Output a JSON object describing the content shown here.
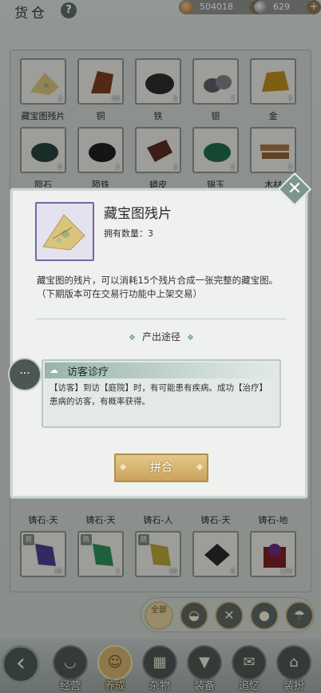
{
  "header": {
    "title": "货仓",
    "help_label": "?",
    "coins": "504018",
    "jade": "629",
    "plus_label": "+"
  },
  "grid_top": [
    {
      "label": "藏宝图残片",
      "count": "3"
    },
    {
      "label": "铜",
      "count": "46"
    },
    {
      "label": "铁",
      "count": "2"
    },
    {
      "label": "银",
      "count": "7"
    },
    {
      "label": "金",
      "count": "3"
    },
    {
      "label": "陨石",
      "count": "5"
    },
    {
      "label": "陨铁",
      "count": "2"
    },
    {
      "label": "蟒皮",
      "count": "3"
    },
    {
      "label": "锡玉",
      "count": "2"
    },
    {
      "label": "木材",
      "count": "5"
    }
  ],
  "grid_mid_labels": [
    "铸石-天",
    "铸石-天",
    "铸石-人",
    "铸石-天",
    "铸石-地"
  ],
  "grid_bottom": [
    {
      "tag": "防",
      "count": "30"
    },
    {
      "tag": "防",
      "count": "1"
    },
    {
      "tag": "防",
      "count": "26"
    },
    {
      "tag": "",
      "count": "8"
    },
    {
      "tag": "",
      "count": "126"
    }
  ],
  "action_bar": {
    "active_label": "全部",
    "icons": [
      "bag-icon",
      "tools-icon",
      "food-icon",
      "umbrella-icon"
    ]
  },
  "bottom_nav": {
    "back_glyph": "‹",
    "items": [
      {
        "label": "经营",
        "icon": "bowl-icon"
      },
      {
        "label": "养成",
        "icon": "person-icon"
      },
      {
        "label": "杂物",
        "icon": "bundle-icon"
      },
      {
        "label": "装备",
        "icon": "armor-icon"
      },
      {
        "label": "追忆",
        "icon": "letter-icon"
      },
      {
        "label": "装扮",
        "icon": "house-icon"
      }
    ]
  },
  "modal": {
    "item_name": "藏宝图残片",
    "count_text": "拥有数量：3",
    "description": "藏宝图的残片，可以消耗15个残片合成一张完整的藏宝图。（下期版本可在交易行功能中上架交易）",
    "section_title": "产出途径",
    "source": {
      "title": "访客诊疗",
      "text": "【访客】到访【庭院】时，有可能患有疾病。成功【治疗】患病的访客，有概率获得。"
    },
    "merge_label": "拼合",
    "close_glyph": "✕"
  },
  "colors": {
    "accent_gold": "#caa25c",
    "rarity_purple": "#6f6aa0",
    "panel_bg": "#eef1ee"
  }
}
